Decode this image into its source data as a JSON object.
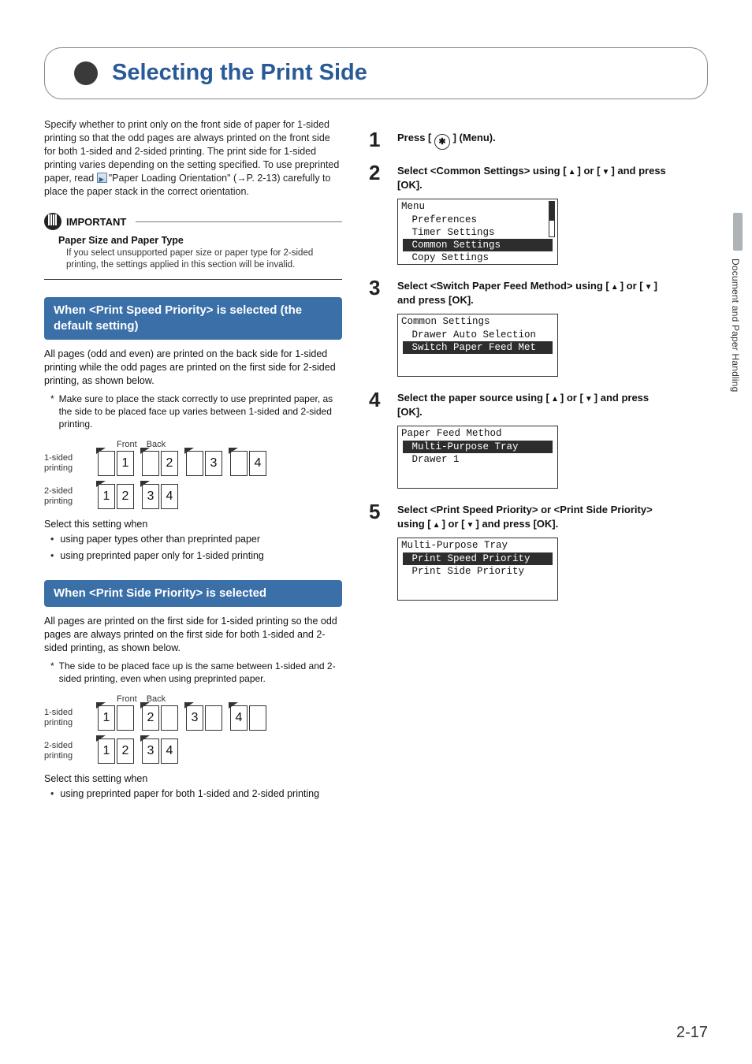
{
  "side_tab": "Document and Paper Handling",
  "title": "Selecting the Print Side",
  "intro": {
    "p1": "Specify whether to print only on the front side of paper for 1-sided printing so that the odd pages are always printed on the front side for both 1-sided and 2-sided printing. The print side for 1-sided printing varies depending on the setting specified. To use preprinted paper, read",
    "link": "\"Paper Loading Orientation\" (→P. 2-13)",
    "p2": " carefully to place the paper stack in the correct orientation."
  },
  "important": {
    "label": "IMPORTANT",
    "sub": "Paper Size and Paper Type",
    "body": "If you select unsupported paper size or paper type for 2-sided printing, the settings applied in this section will be invalid."
  },
  "sec1": {
    "bar": "When <Print Speed Priority> is selected (the default setting)",
    "body": "All pages (odd and even) are printed on the back side for 1-sided printing while the odd pages are printed on the first side for 2-sided printing, as shown below.",
    "note": "Make sure to place the stack correctly to use preprinted paper, as the side to be placed face up varies between 1-sided and 2-sided printing.",
    "front": "Front",
    "back": "Back",
    "row1_label": "1-sided printing",
    "row2_label": "2-sided printing",
    "after": "Select this setting when",
    "li1": "using paper types other than preprinted paper",
    "li2": "using preprinted paper only for 1-sided printing"
  },
  "sec2": {
    "bar": "When <Print Side Priority> is selected",
    "body": "All pages are printed on the first side for 1-sided printing so the odd pages are always printed on the first side for both 1-sided and 2-sided printing, as shown below.",
    "note": "The side to be placed face up is the same between 1-sided and 2-sided printing, even when using preprinted paper.",
    "after": "Select this setting when",
    "li1": "using preprinted paper for both 1-sided and 2-sided printing"
  },
  "steps": {
    "s1": {
      "pre": "Press [ ",
      "post": " ] (Menu)."
    },
    "s2": {
      "pre": "Select <Common Settings> using [",
      "mid": "] or [",
      "post": "] and press [OK]."
    },
    "lcd1": {
      "title": "Menu",
      "l1": " Preferences",
      "l2": " Timer Settings",
      "l3": " Common Settings",
      "l4": " Copy Settings"
    },
    "s3": {
      "pre": "Select <Switch Paper Feed Method> using [",
      "mid": "] or [",
      "post": "] and press [OK]."
    },
    "lcd2": {
      "title": "Common Settings",
      "l1": " Drawer Auto Selection",
      "l2": " Switch Paper Feed Met"
    },
    "s4": {
      "pre": "Select the paper source using [",
      "mid": "] or [",
      "post": "] and press [OK]."
    },
    "lcd3": {
      "title": "Paper Feed Method",
      "l1": " Multi-Purpose Tray",
      "l2": " Drawer 1"
    },
    "s5": {
      "pre": "Select <Print Speed Priority> or <Print Side Priority> using [",
      "mid": "] or [",
      "post": "] and press [OK]."
    },
    "lcd4": {
      "title": "Multi-Purpose Tray",
      "l1": " Print Speed Priority",
      "l2": " Print Side Priority"
    }
  },
  "page_number": "2-17",
  "chart_data": {
    "type": "table",
    "title": "Paper stacking layouts",
    "sections": [
      {
        "mode": "Print Speed Priority",
        "rows": [
          {
            "label": "1-sided printing",
            "pairs": [
              [
                "",
                "1"
              ],
              [
                "",
                "2"
              ],
              [
                "",
                "3"
              ],
              [
                "",
                "4"
              ]
            ]
          },
          {
            "label": "2-sided printing",
            "pairs": [
              [
                "1",
                "2"
              ],
              [
                "3",
                "4"
              ]
            ]
          }
        ]
      },
      {
        "mode": "Print Side Priority",
        "rows": [
          {
            "label": "1-sided printing",
            "pairs": [
              [
                "1",
                ""
              ],
              [
                "2",
                ""
              ],
              [
                "3",
                ""
              ],
              [
                "4",
                ""
              ]
            ]
          },
          {
            "label": "2-sided printing",
            "pairs": [
              [
                "1",
                "2"
              ],
              [
                "3",
                "4"
              ]
            ]
          }
        ]
      }
    ],
    "columns": [
      "Front",
      "Back"
    ]
  }
}
